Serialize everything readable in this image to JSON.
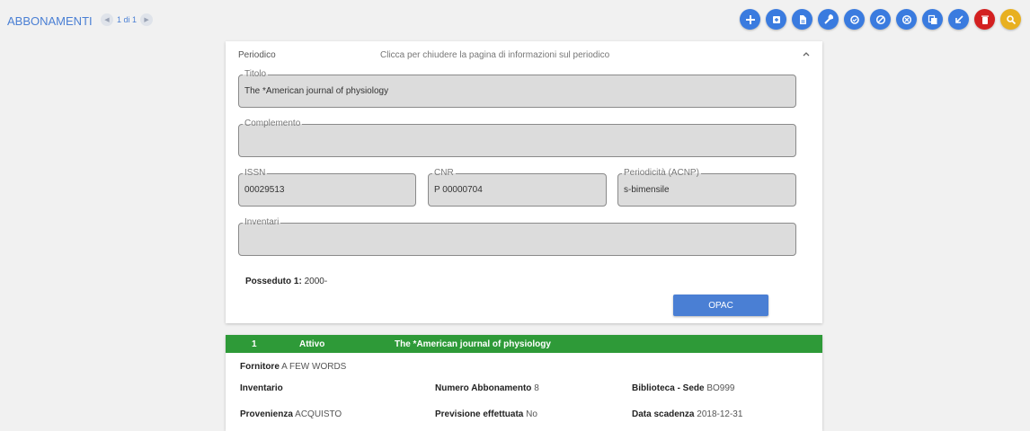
{
  "header": {
    "title": "ABBONAMENTI",
    "pager_text": "1 di 1",
    "prev_icon": "first-page-icon",
    "next_icon": "last-page-icon"
  },
  "actions": [
    {
      "name": "add-icon",
      "color": "#3a7bdf"
    },
    {
      "name": "add-copy-icon",
      "color": "#3a7bdf"
    },
    {
      "name": "document-icon",
      "color": "#3a7bdf"
    },
    {
      "name": "wrench-icon",
      "color": "#3a7bdf"
    },
    {
      "name": "sync-icon",
      "color": "#3a7bdf"
    },
    {
      "name": "block-icon",
      "color": "#3a7bdf"
    },
    {
      "name": "cancel-icon",
      "color": "#3a7bdf"
    },
    {
      "name": "copy-icon",
      "color": "#3a7bdf"
    },
    {
      "name": "arrow-down-left-icon",
      "color": "#3a7bdf"
    },
    {
      "name": "trash-icon",
      "color": "#d32020"
    },
    {
      "name": "search-icon",
      "color": "#e8b020"
    }
  ],
  "periodico": {
    "heading": "Periodico",
    "hint": "Clicca per chiudere la pagina di informazioni sul periodico",
    "titolo_label": "Titolo",
    "titolo_value": "The *American journal of physiology",
    "complemento_label": "Complemento",
    "complemento_value": "",
    "issn_label": "ISSN",
    "issn_value": "00029513",
    "cnr_label": "CNR",
    "cnr_value": "P 00000704",
    "periodicita_label": "Periodicità (ACNP)",
    "periodicita_value": "s-bimensile",
    "inventari_label": "Inventari",
    "inventari_value": "",
    "posseduto_label": "Posseduto 1:",
    "posseduto_value": "2000-",
    "opac_label": "OPAC"
  },
  "abbonamento": {
    "index": "1",
    "stato": "Attivo",
    "titolo": "The *American journal of physiology",
    "fornitore_label": "Fornitore",
    "fornitore_value": "A FEW WORDS",
    "inventario_label": "Inventario",
    "numero_label": "Numero Abbonamento",
    "numero_value": "8",
    "biblioteca_label": "Biblioteca - Sede",
    "biblioteca_value": "BO999",
    "provenienza_label": "Provenienza",
    "provenienza_value": "ACQUISTO",
    "previsione_label": "Previsione effettuata",
    "previsione_value": "No",
    "scadenza_label": "Data scadenza",
    "scadenza_value": "2018-12-31",
    "header_color": "#2e9a38"
  }
}
